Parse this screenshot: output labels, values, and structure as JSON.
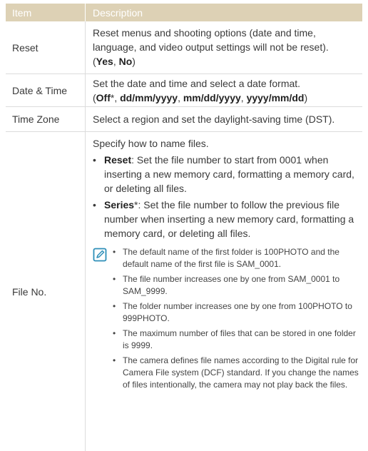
{
  "header": {
    "col1": "Item",
    "col2": "Description"
  },
  "rows": {
    "reset": {
      "item": "Reset",
      "desc": "Reset menus and shooting options (date and time, language, and video output settings will not be reset).",
      "opt_open": "(",
      "opt1": "Yes",
      "opt_sep": ", ",
      "opt2": "No",
      "opt_close": ")"
    },
    "date_time": {
      "item": "Date & Time",
      "desc": "Set the date and time and select a date format.",
      "opt_open": "(",
      "opt1": "Off",
      "opt1_mark": "*",
      "opt_sep": ", ",
      "opt2": "dd/mm/yyyy",
      "opt3": "mm/dd/yyyy",
      "opt4": "yyyy/mm/dd",
      "opt_close": ")"
    },
    "time_zone": {
      "item": "Time Zone",
      "desc": "Select a region and set the daylight-saving time (DST)."
    },
    "file_no": {
      "item": "File No.",
      "intro": "Specify how to name files.",
      "bullets": [
        {
          "term": "Reset",
          "mark": "",
          "text": ": Set the file number to start from 0001 when inserting a new memory card, formatting a memory card, or deleting all files."
        },
        {
          "term": "Series",
          "mark": "*",
          "text": ": Set the file number to follow the previous file number when inserting a new memory card, formatting a memory card, or deleting all files."
        }
      ],
      "notes": [
        "The default name of the first folder is 100PHOTO and the default name of the first file is SAM_0001.",
        "The file number increases one by one from SAM_0001 to SAM_9999.",
        "The folder number increases one by one from 100PHOTO to 999PHOTO.",
        "The maximum number of files that can be stored in one folder is 9999.",
        "The camera defines file names according to the Digital rule for Camera File system (DCF) standard. If you change the names of files intentionally, the camera may not play back the files."
      ]
    }
  },
  "bullet_char": "•",
  "note_icon": "note-pencil-icon",
  "colors": {
    "header_bg": "#ddd1b5",
    "accent": "#2d8fb8"
  }
}
